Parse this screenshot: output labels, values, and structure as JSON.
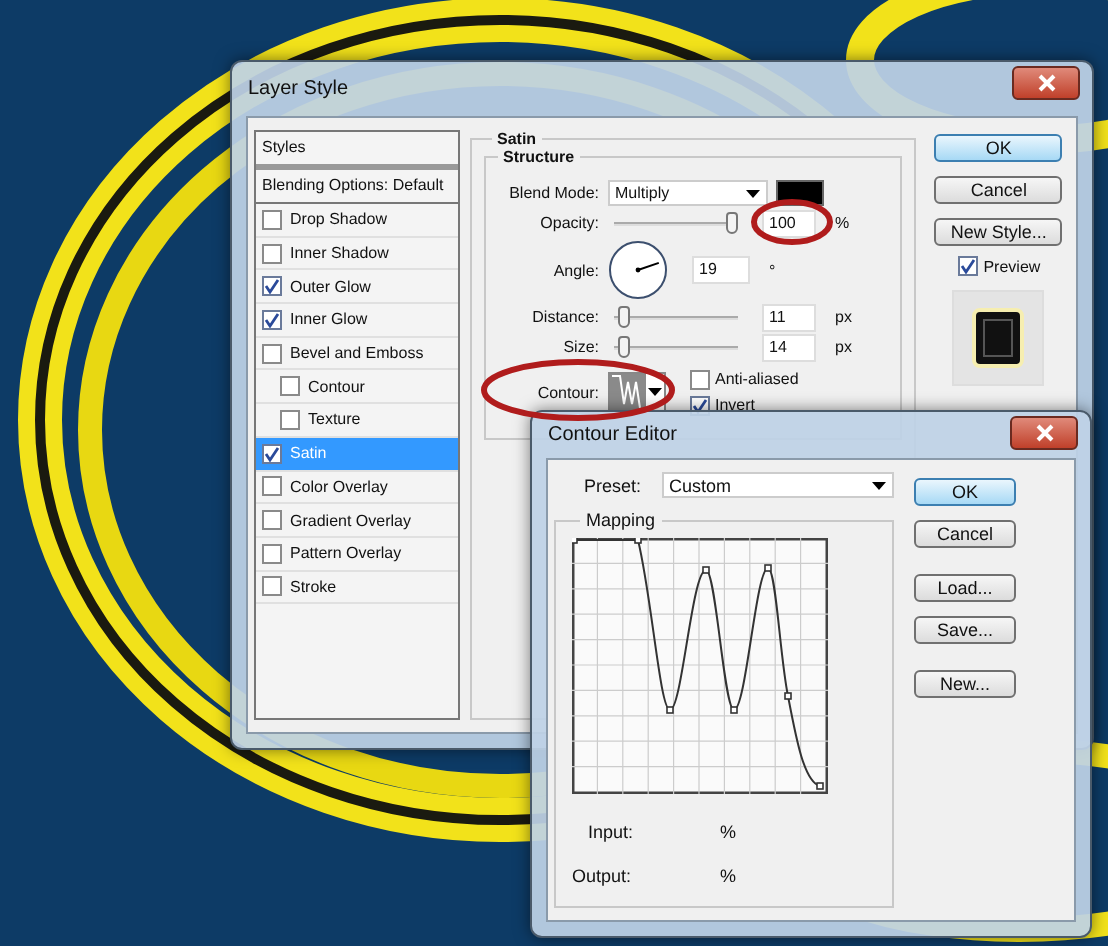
{
  "layer_style": {
    "title": "Layer Style",
    "styles_header": "Styles",
    "blending_options": "Blending Options: Default",
    "effects": [
      {
        "label": "Drop Shadow",
        "checked": false,
        "selected": false
      },
      {
        "label": "Inner Shadow",
        "checked": false,
        "selected": false
      },
      {
        "label": "Outer Glow",
        "checked": true,
        "selected": false
      },
      {
        "label": "Inner Glow",
        "checked": true,
        "selected": false
      },
      {
        "label": "Bevel and Emboss",
        "checked": false,
        "selected": false,
        "children": [
          {
            "label": "Contour",
            "checked": false,
            "selected": false
          },
          {
            "label": "Texture",
            "checked": false,
            "selected": false
          }
        ]
      },
      {
        "label": "Satin",
        "checked": true,
        "selected": true
      },
      {
        "label": "Color Overlay",
        "checked": false,
        "selected": false
      },
      {
        "label": "Gradient Overlay",
        "checked": false,
        "selected": false
      },
      {
        "label": "Pattern Overlay",
        "checked": false,
        "selected": false
      },
      {
        "label": "Stroke",
        "checked": false,
        "selected": false
      }
    ],
    "section_title": "Satin",
    "group_title": "Structure",
    "blend_mode": {
      "label": "Blend Mode:",
      "value": "Multiply"
    },
    "opacity": {
      "label": "Opacity:",
      "level": 1,
      "value": "100",
      "unit": "%"
    },
    "angle": {
      "label": "Angle:",
      "value": "19",
      "unit": "°"
    },
    "distance": {
      "label": "Distance:",
      "level": 0.05,
      "value": "11",
      "unit": "px"
    },
    "size": {
      "label": "Size:",
      "level": 0.05,
      "value": "14",
      "unit": "px"
    },
    "contour": {
      "label": "Contour:"
    },
    "anti_aliased": {
      "label": "Anti-aliased",
      "checked": false
    },
    "invert": {
      "label": "Invert",
      "checked": true
    },
    "buttons": [
      {
        "label": "OK",
        "default": true
      },
      {
        "label": "Cancel",
        "default": false
      },
      {
        "label": "New Style...",
        "default": false
      }
    ],
    "preview": {
      "label": "Preview",
      "checked": true
    }
  },
  "contour_editor": {
    "title": "Contour Editor",
    "preset": {
      "label": "Preset:",
      "value": "Custom"
    },
    "mapping_title": "Mapping",
    "input": {
      "label": "Input:",
      "unit": "%"
    },
    "output": {
      "label": "Output:",
      "unit": "%"
    },
    "buttons": [
      {
        "label": "OK",
        "default": true
      },
      {
        "label": "Cancel",
        "default": false
      },
      {
        "label": "Load...",
        "default": false
      },
      {
        "label": "Save...",
        "default": false
      },
      {
        "label": "New...",
        "default": false
      }
    ]
  }
}
